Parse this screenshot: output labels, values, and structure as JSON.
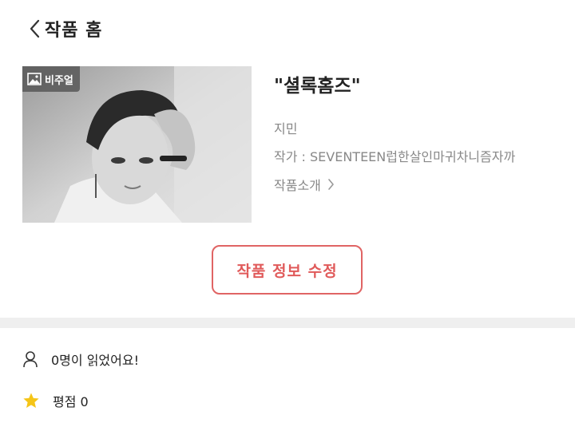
{
  "header": {
    "title": "작품 홈"
  },
  "thumbnail": {
    "badge_label": "비주얼"
  },
  "work": {
    "title": "\"셜록홈즈\"",
    "author": "지민",
    "writer": "작가 : SEVENTEEN럽한살인마귀차니즘자까",
    "intro_label": "작품소개"
  },
  "edit_button_label": "작품 정보 수정",
  "stats": {
    "readers": "0명이 읽었어요!",
    "rating": "평점 0"
  },
  "colors": {
    "accent": "#e05a5a",
    "star": "#f5c518",
    "divider": "#efefef"
  }
}
